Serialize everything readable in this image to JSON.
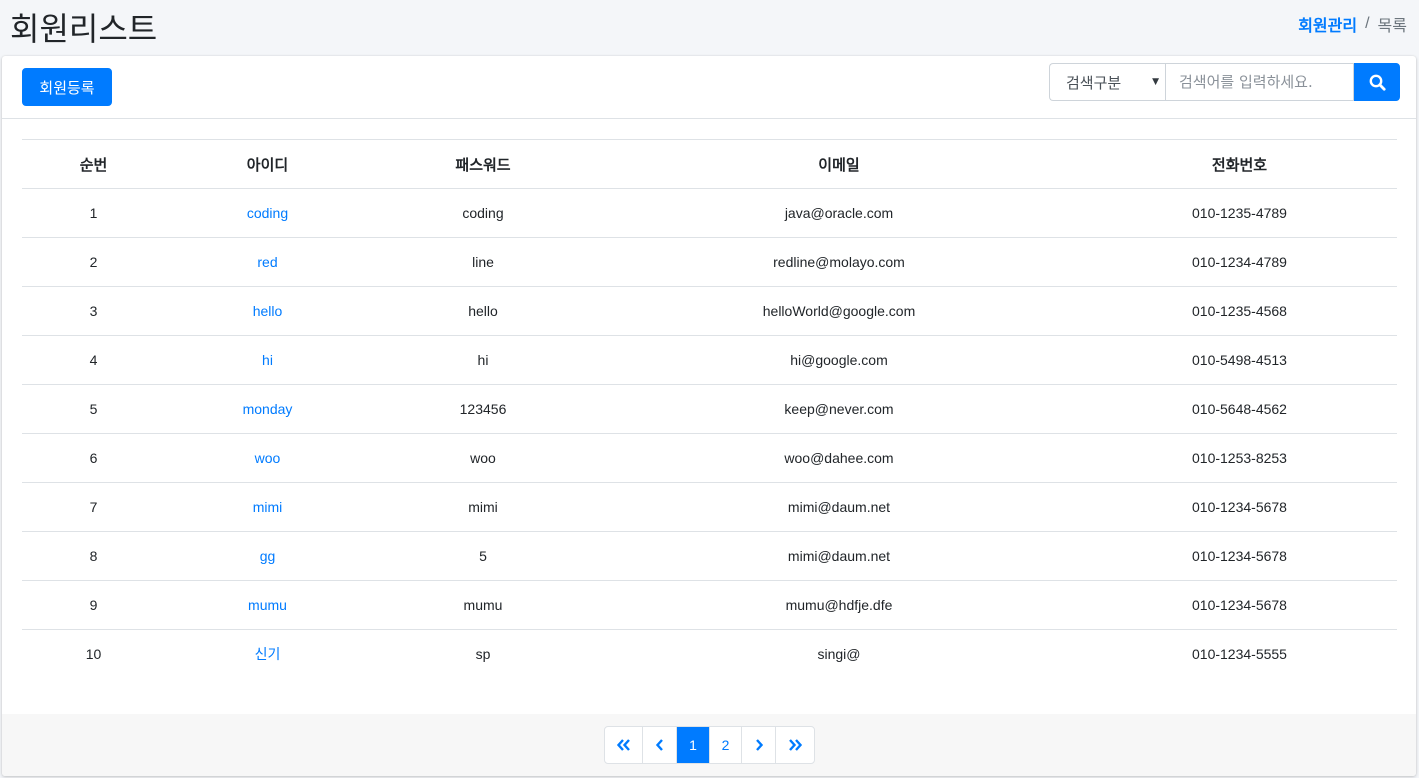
{
  "header": {
    "title": "회원리스트",
    "breadcrumb": {
      "link": "회원관리",
      "separator": "/",
      "current": "목록"
    }
  },
  "toolbar": {
    "register_label": "회원등록",
    "search": {
      "select_value": "검색구분",
      "placeholder": "검색어를 입력하세요.",
      "button_icon": "search-icon"
    }
  },
  "table": {
    "columns": [
      "순번",
      "아이디",
      "패스워드",
      "이메일",
      "전화번호"
    ],
    "rows": [
      [
        "1",
        "coding",
        "coding",
        "java@oracle.com",
        "010-1235-4789"
      ],
      [
        "2",
        "red",
        "line",
        "redline@molayo.com",
        "010-1234-4789"
      ],
      [
        "3",
        "hello",
        "hello",
        "helloWorld@google.com",
        "010-1235-4568"
      ],
      [
        "4",
        "hi",
        "hi",
        "hi@google.com",
        "010-5498-4513"
      ],
      [
        "5",
        "monday",
        "123456",
        "keep@never.com",
        "010-5648-4562"
      ],
      [
        "6",
        "woo",
        "woo",
        "woo@dahee.com",
        "010-1253-8253"
      ],
      [
        "7",
        "mimi",
        "mimi",
        "mimi@daum.net",
        "010-1234-5678"
      ],
      [
        "8",
        "gg",
        "5",
        "mimi@daum.net",
        "010-1234-5678"
      ],
      [
        "9",
        "mumu",
        "mumu",
        "mumu@hdfje.dfe",
        "010-1234-5678"
      ],
      [
        "10",
        "신기",
        "sp",
        "singi@",
        "010-1234-5555"
      ]
    ]
  },
  "pagination": {
    "first": "«",
    "prev": "‹",
    "pages": [
      "1",
      "2"
    ],
    "active": "1",
    "next": "›",
    "last": "»"
  },
  "colors": {
    "accent": "#007bff",
    "background": "#f4f6f9",
    "border": "#dee2e6"
  }
}
